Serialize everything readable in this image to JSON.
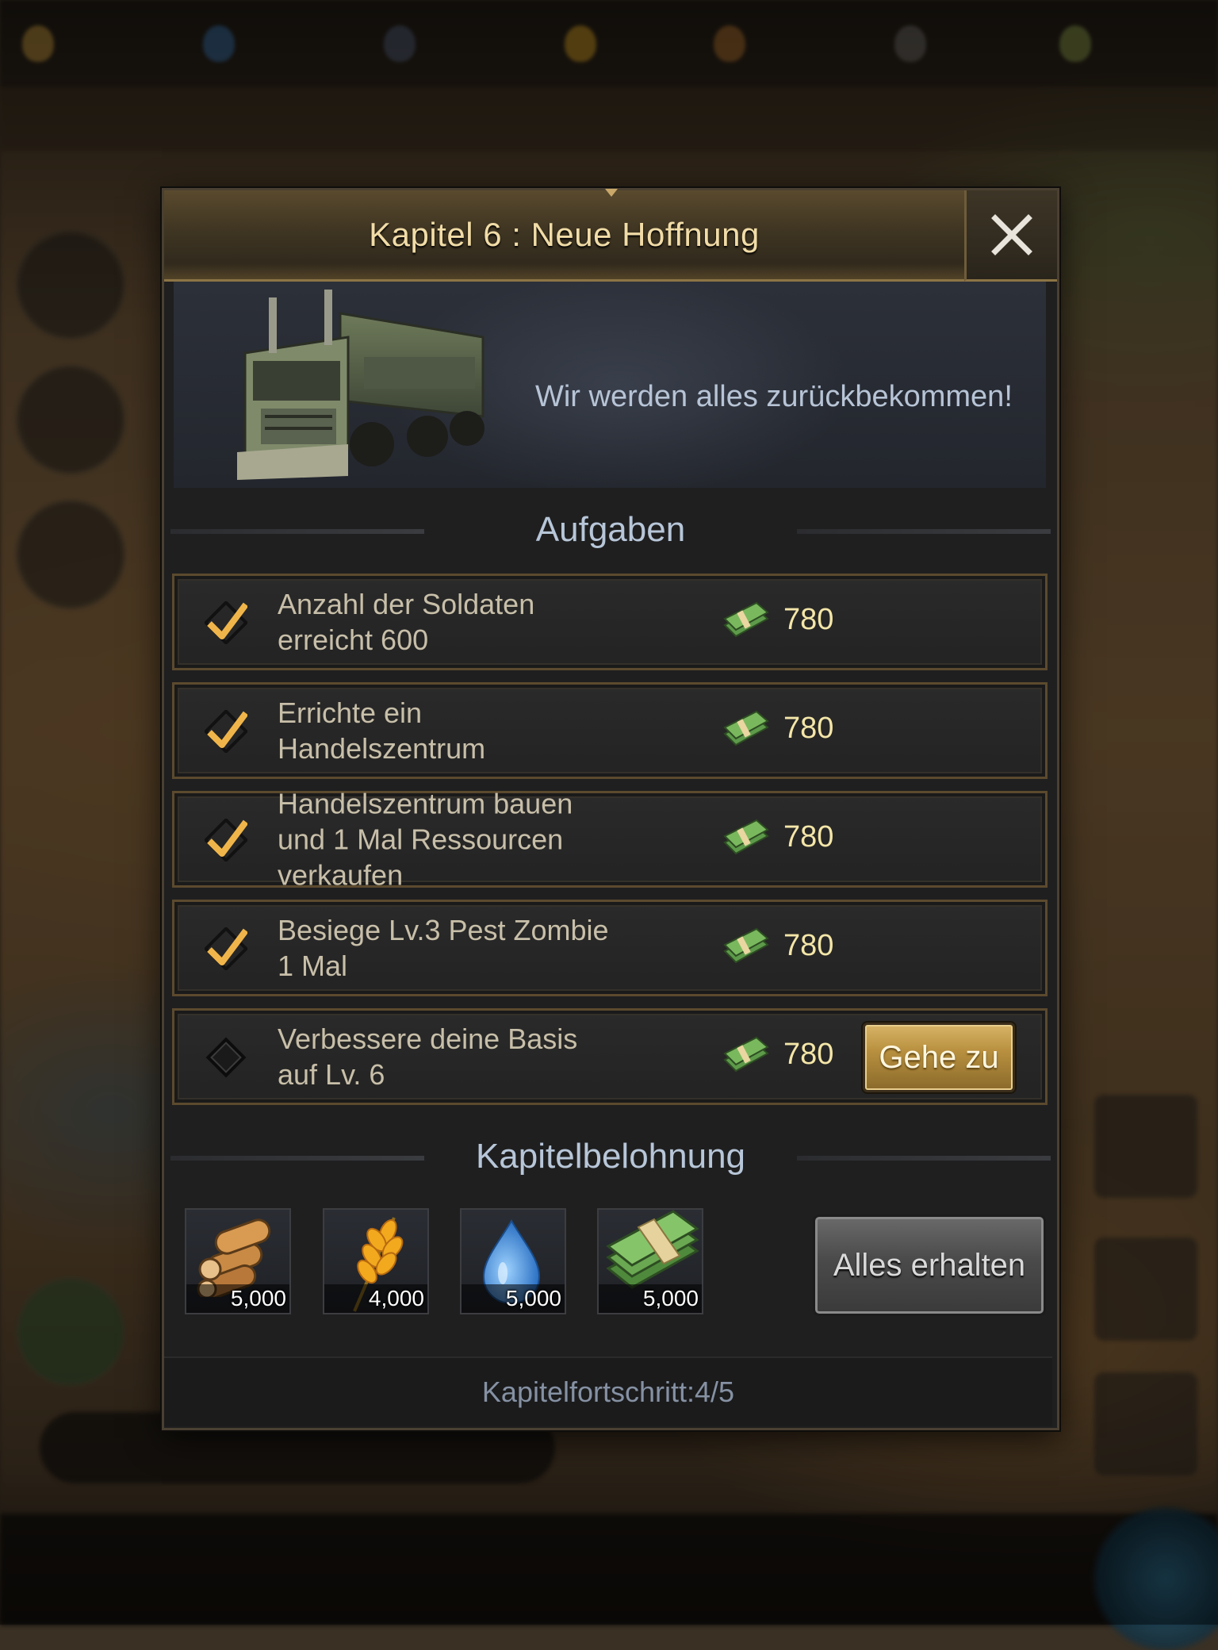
{
  "dialog": {
    "title": "Kapitel 6 : Neue Hoffnung",
    "banner_text": "Wir werden alles zurückbekommen!",
    "tasks_heading": "Aufgaben",
    "reward_heading": "Kapitelbelohnung",
    "progress_text": "Kapitelfortschritt:4/5",
    "tasks": [
      {
        "label_line1": "Anzahl der Soldaten",
        "label_line2": "erreicht 600",
        "label_line3": "",
        "reward": "780",
        "completed": true
      },
      {
        "label_line1": "Errichte ein",
        "label_line2": "Handelszentrum",
        "label_line3": "",
        "reward": "780",
        "completed": true
      },
      {
        "label_line1": "Handelszentrum bauen",
        "label_line2": "und 1 Mal Ressourcen",
        "label_line3": "verkaufen",
        "reward": "780",
        "completed": true
      },
      {
        "label_line1": "Besiege Lv.3 Pest Zombie",
        "label_line2": "1 Mal",
        "label_line3": "",
        "reward": "780",
        "completed": true
      },
      {
        "label_line1": "Verbessere deine Basis",
        "label_line2": "auf Lv. 6",
        "label_line3": "",
        "reward": "780",
        "completed": false
      }
    ],
    "goto_label": "Gehe zu",
    "rewards": [
      {
        "icon": "wood-icon",
        "amount": "5,000"
      },
      {
        "icon": "wheat-icon",
        "amount": "4,000"
      },
      {
        "icon": "water-drop-icon",
        "amount": "5,000"
      },
      {
        "icon": "cash-icon",
        "amount": "5,000"
      }
    ],
    "claim_all_label": "Alles erhalten"
  },
  "colors": {
    "title": "#f1dca7",
    "reward_value": "#f4e6a8",
    "check": "#f0b54a",
    "heading": "#b7c6d8"
  }
}
